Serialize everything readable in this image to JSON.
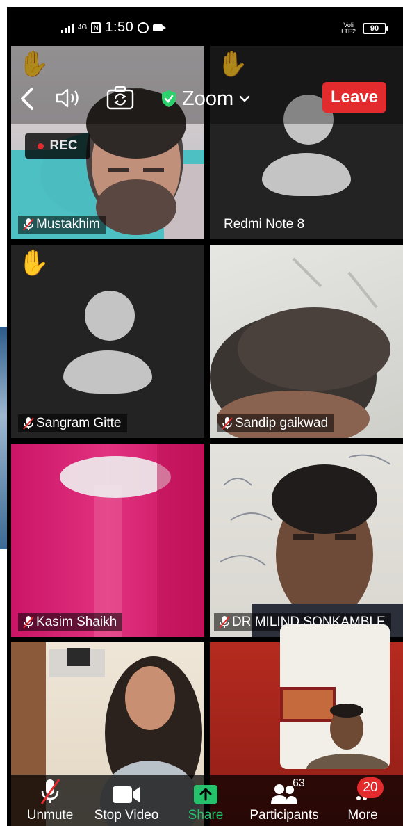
{
  "status_bar": {
    "network": "4G",
    "time": "1:50",
    "lte_top": "Voli",
    "lte_bottom": "LTE2",
    "battery": "90"
  },
  "meeting": {
    "title": "Zoom",
    "leave_label": "Leave",
    "rec_label": "REC"
  },
  "participants": [
    {
      "name": "Mustakhim",
      "muted": true,
      "hand_raised": true
    },
    {
      "name": "Redmi Note 8",
      "muted": false,
      "hand_raised": true
    },
    {
      "name": "Sangram Gitte",
      "muted": true,
      "hand_raised": true
    },
    {
      "name": "Sandip gaikwad",
      "muted": true,
      "hand_raised": false
    },
    {
      "name": "Kasim Shaikh",
      "muted": true,
      "hand_raised": false
    },
    {
      "name": "DR MILIND SONKAMBLE",
      "muted": true,
      "hand_raised": false
    }
  ],
  "toolbar": {
    "unmute_label": "Unmute",
    "stop_video_label": "Stop Video",
    "share_label": "Share",
    "participants_label": "Participants",
    "participants_count": "63",
    "more_label": "More",
    "more_badge": "20"
  },
  "colors": {
    "leave": "#e32b2d",
    "share": "#25c26b",
    "shield": "#2bd16b"
  }
}
